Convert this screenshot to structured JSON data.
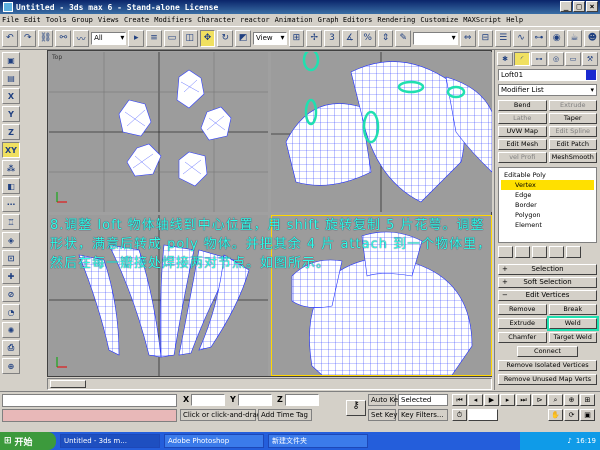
{
  "window": {
    "title": "Untitled - 3ds max 6 - Stand-alone License",
    "minimize": "_",
    "maximize": "□",
    "close": "×"
  },
  "menu": [
    "File",
    "Edit",
    "Tools",
    "Group",
    "Views",
    "Create",
    "Modifiers",
    "Character",
    "reactor",
    "Animation",
    "Graph Editors",
    "Rendering",
    "Customize",
    "MAXScript",
    "Help"
  ],
  "toolbar": {
    "selection_filter": "All",
    "reference_coord": "View"
  },
  "left_tools": [
    "X",
    "Y",
    "Z",
    "XY"
  ],
  "viewports": {
    "top_label": "Top"
  },
  "annotation": {
    "text": "8.调整 loft 物体轴线到中心位置，用 shift 旋转复制 5 片花萼。调整形状，满意后转成 poly 物体。并把其余 4 片 attach 到一个物体里，然后在每一瓣接处焊接两对节点。如图所示。"
  },
  "command_panel": {
    "object_name": "Loft01",
    "object_color": "#1a2ad0",
    "modifier_list": "Modifier List",
    "modifier_buttons": [
      {
        "label": "Bend",
        "dim": false
      },
      {
        "label": "Extrude",
        "dim": true
      },
      {
        "label": "Lathe",
        "dim": true
      },
      {
        "label": "Taper",
        "dim": false
      },
      {
        "label": "UVW Map",
        "dim": false
      },
      {
        "label": "Edit Spline",
        "dim": true
      },
      {
        "label": "Edit Mesh",
        "dim": false
      },
      {
        "label": "Edit Patch",
        "dim": false
      },
      {
        "label": "vel Profi",
        "dim": true
      },
      {
        "label": "MeshSmooth",
        "dim": false
      }
    ],
    "stack": {
      "root": "Editable Poly",
      "items": [
        "Vertex",
        "Edge",
        "Border",
        "Polygon",
        "Element"
      ],
      "selected": "Vertex"
    },
    "rollouts": {
      "selection": "Selection",
      "soft_selection": "Soft Selection",
      "edit_vertices": "Edit Vertices"
    },
    "edit_vertices": {
      "remove": "Remove",
      "break": "Break",
      "extrude": "Extrude",
      "weld": "Weld",
      "chamfer": "Chamfer",
      "target_weld": "Target Weld",
      "connect": "Connect",
      "remove_isolated": "Remove Isolated Vertices",
      "remove_unused": "Remove Unused Map Verts"
    }
  },
  "status": {
    "prompt": "Click or click-and-drag",
    "add_time_tag": "Add Time Tag",
    "x_label": "X",
    "y_label": "Y",
    "z_label": "Z",
    "auto_key": "Auto Key",
    "set_key": "Set Key",
    "selected": "Selected",
    "key_filters": "Key Filters..."
  },
  "taskbar": {
    "start": "开始",
    "tasks": [
      "Untitled - 3ds m...",
      "Adobe Photoshop",
      "新建文件夹"
    ],
    "time": "16:19"
  }
}
